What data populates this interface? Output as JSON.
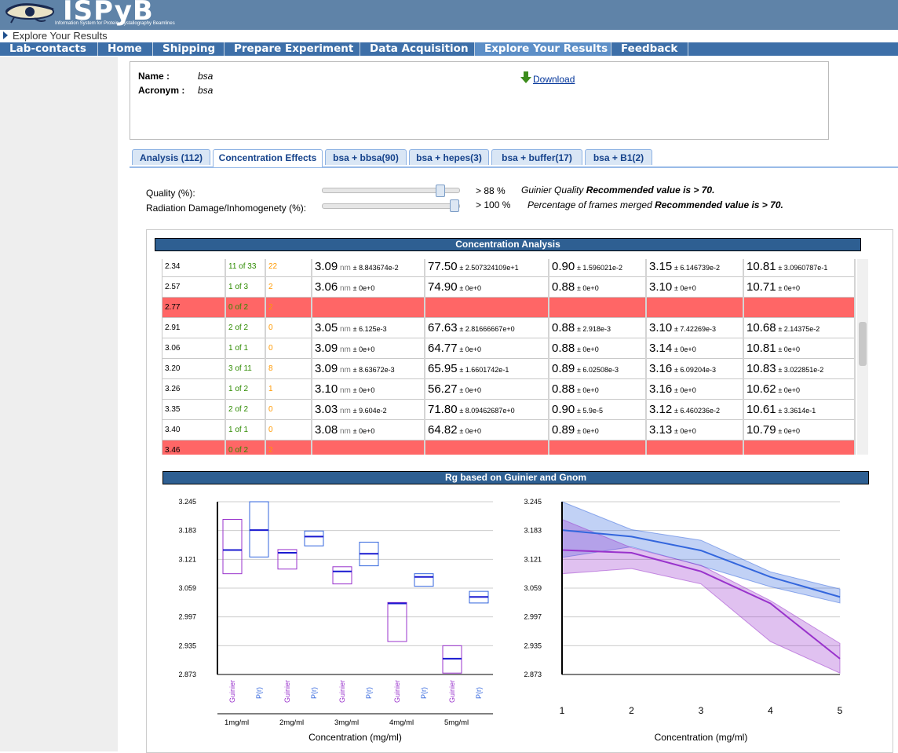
{
  "app": {
    "logo_text": "ISPyB",
    "logo_subtitle": "Information System for Protein crystallography Beamlines"
  },
  "breadcrumb": "Explore Your Results",
  "menu": [
    {
      "label": "Lab-contacts"
    },
    {
      "label": "Home"
    },
    {
      "label": "Shipping"
    },
    {
      "label": "Prepare Experiment"
    },
    {
      "label": "Data Acquisition"
    },
    {
      "label": "Explore Your Results",
      "active": true
    },
    {
      "label": "Feedback"
    }
  ],
  "info": {
    "name_label": "Name :",
    "name": "bsa",
    "acronym_label": "Acronym :",
    "acronym": "bsa",
    "download": "Download"
  },
  "tabs": [
    {
      "label": "Analysis (112)"
    },
    {
      "label": "Concentration Effects",
      "active": true
    },
    {
      "label": "bsa + bbsa(90)"
    },
    {
      "label": "bsa + hepes(3)"
    },
    {
      "label": "bsa + buffer(17)"
    },
    {
      "label": "bsa + B1(2)"
    }
  ],
  "filters": {
    "quality_label": "Quality (%):",
    "quality_value": "> 88 %",
    "quality_level": 88,
    "quality_note_italic": "Guinier Quality ",
    "quality_note_bold": "Recommended value is > 70.",
    "damage_label": "Radiation Damage/Inhomogenety (%):",
    "damage_value": "> 100 %",
    "damage_level": 100,
    "damage_note_italic": "Percentage of frames merged ",
    "damage_note_bold": "Recommended value is > 70."
  },
  "table": {
    "title": "Concentration Analysis",
    "rows": [
      {
        "conc": "2.34",
        "frames": "11 of 33",
        "n": "22",
        "rg": "3.09",
        "rg_err": "8.843674e-2",
        "i0": "77.50",
        "i0_err": "2.507324109e+1",
        "q": "0.90",
        "q_err": "1.596021e-2",
        "rgg": "3.15",
        "rgg_err": "6.146739e-2",
        "dmax": "10.81",
        "dmax_err": "3.0960787e-1"
      },
      {
        "conc": "2.57",
        "frames": "1 of 3",
        "n": "2",
        "rg": "3.06",
        "rg_err": "0e+0",
        "i0": "74.90",
        "i0_err": "0e+0",
        "q": "0.88",
        "q_err": "0e+0",
        "rgg": "3.10",
        "rgg_err": "0e+0",
        "dmax": "10.71",
        "dmax_err": "0e+0"
      },
      {
        "conc": "2.77",
        "frames": "0 of 2",
        "n": "2",
        "bad": true
      },
      {
        "conc": "2.91",
        "frames": "2 of 2",
        "n": "0",
        "rg": "3.05",
        "rg_err": "6.125e-3",
        "i0": "67.63",
        "i0_err": "2.81666667e+0",
        "q": "0.88",
        "q_err": "2.918e-3",
        "rgg": "3.10",
        "rgg_err": "7.42269e-3",
        "dmax": "10.68",
        "dmax_err": "2.14375e-2"
      },
      {
        "conc": "3.06",
        "frames": "1 of 1",
        "n": "0",
        "rg": "3.09",
        "rg_err": "0e+0",
        "i0": "64.77",
        "i0_err": "0e+0",
        "q": "0.88",
        "q_err": "0e+0",
        "rgg": "3.14",
        "rgg_err": "0e+0",
        "dmax": "10.81",
        "dmax_err": "0e+0"
      },
      {
        "conc": "3.20",
        "frames": "3 of 11",
        "n": "8",
        "rg": "3.09",
        "rg_err": "8.63672e-3",
        "i0": "65.95",
        "i0_err": "1.6601742e-1",
        "q": "0.89",
        "q_err": "6.02508e-3",
        "rgg": "3.16",
        "rgg_err": "6.09204e-3",
        "dmax": "10.83",
        "dmax_err": "3.022851e-2"
      },
      {
        "conc": "3.26",
        "frames": "1 of 2",
        "n": "1",
        "rg": "3.10",
        "rg_err": "0e+0",
        "i0": "56.27",
        "i0_err": "0e+0",
        "q": "0.88",
        "q_err": "0e+0",
        "rgg": "3.16",
        "rgg_err": "0e+0",
        "dmax": "10.62",
        "dmax_err": "0e+0"
      },
      {
        "conc": "3.35",
        "frames": "2 of 2",
        "n": "0",
        "rg": "3.03",
        "rg_err": "9.604e-2",
        "i0": "71.80",
        "i0_err": "8.09462687e+0",
        "q": "0.90",
        "q_err": "5.9e-5",
        "rgg": "3.12",
        "rgg_err": "6.460236e-2",
        "dmax": "10.61",
        "dmax_err": "3.3614e-1"
      },
      {
        "conc": "3.40",
        "frames": "1 of 1",
        "n": "0",
        "rg": "3.08",
        "rg_err": "0e+0",
        "i0": "64.82",
        "i0_err": "0e+0",
        "q": "0.89",
        "q_err": "0e+0",
        "rgg": "3.13",
        "rgg_err": "0e+0",
        "dmax": "10.79",
        "dmax_err": "0e+0"
      },
      {
        "conc": "3.46",
        "frames": "0 of 2",
        "n": "2",
        "bad": true
      }
    ],
    "unit_nm": "nm",
    "pm": "±"
  },
  "chart_title": "Rg based on Guinier and Gnom",
  "chart_data": [
    {
      "type": "box",
      "xlabel": "Concentration (mg/ml)",
      "yticks": [
        "3.245",
        "3.183",
        "3.121",
        "3.059",
        "2.997",
        "2.935",
        "2.873"
      ],
      "ylim": [
        2.873,
        3.245
      ],
      "categories": [
        "1mg/ml",
        "2mg/ml",
        "3mg/ml",
        "4mg/ml",
        "5mg/ml"
      ],
      "sublabels": [
        "Guinier",
        "P(r)"
      ],
      "colors": {
        "Guinier": "#9933cc",
        "P(r)": "#3366dd"
      },
      "boxes": [
        {
          "cat": 0,
          "sub": "Guinier",
          "q1": 3.09,
          "median": 3.141,
          "q3": 3.207
        },
        {
          "cat": 0,
          "sub": "P(r)",
          "q1": 3.126,
          "median": 3.184,
          "q3": 3.245
        },
        {
          "cat": 1,
          "sub": "Guinier",
          "q1": 3.1,
          "median": 3.135,
          "q3": 3.142
        },
        {
          "cat": 1,
          "sub": "P(r)",
          "q1": 3.15,
          "median": 3.17,
          "q3": 3.182
        },
        {
          "cat": 2,
          "sub": "Guinier",
          "q1": 3.068,
          "median": 3.095,
          "q3": 3.105
        },
        {
          "cat": 2,
          "sub": "P(r)",
          "q1": 3.107,
          "median": 3.133,
          "q3": 3.158
        },
        {
          "cat": 3,
          "sub": "Guinier",
          "q1": 2.944,
          "median": 3.026,
          "q3": 3.028
        },
        {
          "cat": 3,
          "sub": "P(r)",
          "q1": 3.063,
          "median": 3.083,
          "q3": 3.09
        },
        {
          "cat": 4,
          "sub": "Guinier",
          "q1": 2.876,
          "median": 2.907,
          "q3": 2.935
        },
        {
          "cat": 4,
          "sub": "P(r)",
          "q1": 3.027,
          "median": 3.04,
          "q3": 3.052
        }
      ]
    },
    {
      "type": "line",
      "xlabel": "Concentration (mg/ml)",
      "x": [
        1,
        2,
        3,
        4,
        5
      ],
      "yticks": [
        "3.245",
        "3.183",
        "3.121",
        "3.059",
        "2.997",
        "2.935",
        "2.873"
      ],
      "ylim": [
        2.873,
        3.245
      ],
      "series": [
        {
          "color": "#3366dd",
          "values": [
            3.184,
            3.17,
            3.14,
            3.083,
            3.04
          ],
          "lower": [
            3.125,
            3.148,
            3.107,
            3.062,
            3.027
          ],
          "upper": [
            3.245,
            3.185,
            3.162,
            3.094,
            3.057
          ]
        },
        {
          "color": "#9933cc",
          "values": [
            3.141,
            3.135,
            3.095,
            3.026,
            2.907
          ],
          "lower": [
            3.09,
            3.101,
            3.068,
            2.944,
            2.876
          ],
          "upper": [
            3.207,
            3.146,
            3.108,
            3.032,
            2.94
          ]
        }
      ]
    }
  ]
}
